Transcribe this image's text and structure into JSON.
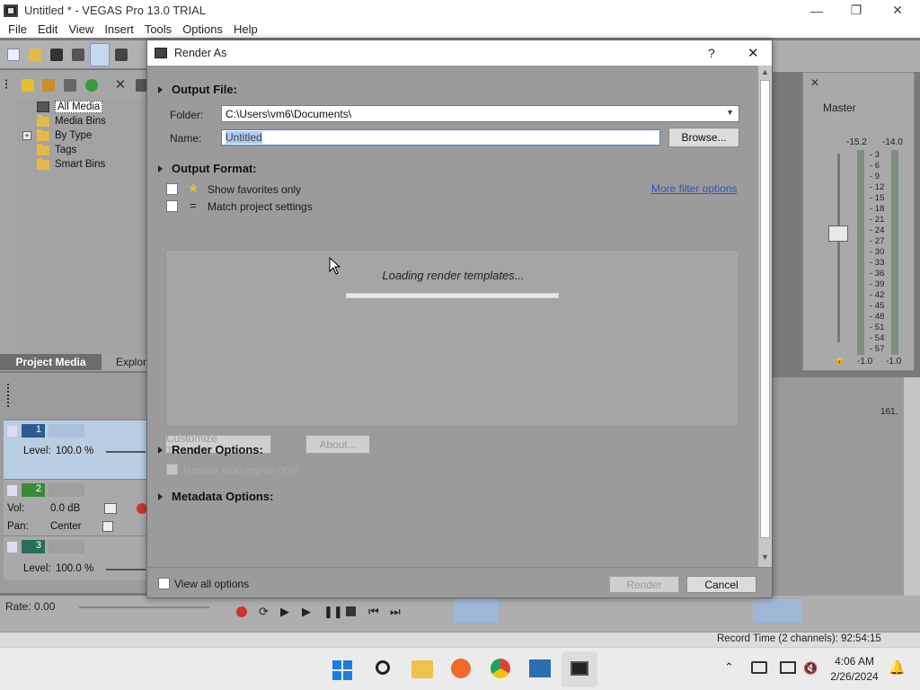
{
  "window": {
    "title": "Untitled * - VEGAS Pro 13.0 TRIAL"
  },
  "menu": [
    "File",
    "Edit",
    "View",
    "Insert",
    "Tools",
    "Options",
    "Help"
  ],
  "project_media": {
    "tree": [
      "All Media",
      "Media Bins",
      "By Type",
      "Tags",
      "Smart Bins"
    ],
    "tabs": {
      "project_media": "Project Media",
      "explorer": "Explore"
    }
  },
  "tracks": [
    {
      "num": "1",
      "label1": "Level:",
      "value1": "100.0 %"
    },
    {
      "num": "2",
      "label1": "Vol:",
      "value1": "0.0 dB",
      "label2": "Pan:",
      "value2": "Center"
    },
    {
      "num": "3",
      "label1": "Level:",
      "value1": "100.0 %"
    }
  ],
  "master": {
    "title": "Master",
    "left_peak": "-15.2",
    "right_peak": "-14.0",
    "scale": [
      "3",
      "6",
      "9",
      "12",
      "15",
      "18",
      "21",
      "24",
      "27",
      "30",
      "33",
      "36",
      "39",
      "42",
      "45",
      "48",
      "51",
      "54",
      "57"
    ],
    "bottom_left": "-1.0",
    "bottom_right": "-1.0"
  },
  "timeline": {
    "marker": "161."
  },
  "transport": {
    "rate": "Rate: 0.00"
  },
  "status": {
    "record_time": "Record Time (2 channels): 92:54:15"
  },
  "dialog": {
    "title": "Render As",
    "help": "?",
    "close": "✕",
    "output_file": "Output File:",
    "folder_label": "Folder:",
    "folder_value": "C:\\Users\\vm6\\Documents\\",
    "name_label": "Name:",
    "name_value": "Untitled",
    "browse": "Browse...",
    "output_format": "Output Format:",
    "show_favorites": "Show favorites only",
    "match_settings": "Match project settings",
    "more_filter": "More filter options",
    "loading": "Loading render templates...",
    "customize": "Customize Template...",
    "about": "About...",
    "render_options": "Render Options:",
    "render_loop": "Render loop region only",
    "metadata_options": "Metadata Options:",
    "view_all": "View all options",
    "render": "Render",
    "cancel": "Cancel"
  },
  "taskbar": {
    "time": "4:06 AM",
    "date": "2/26/2024"
  },
  "colors": {
    "accent": "#2a56c6",
    "selection": "#aecbf0",
    "panel": "#9b9b9b"
  }
}
